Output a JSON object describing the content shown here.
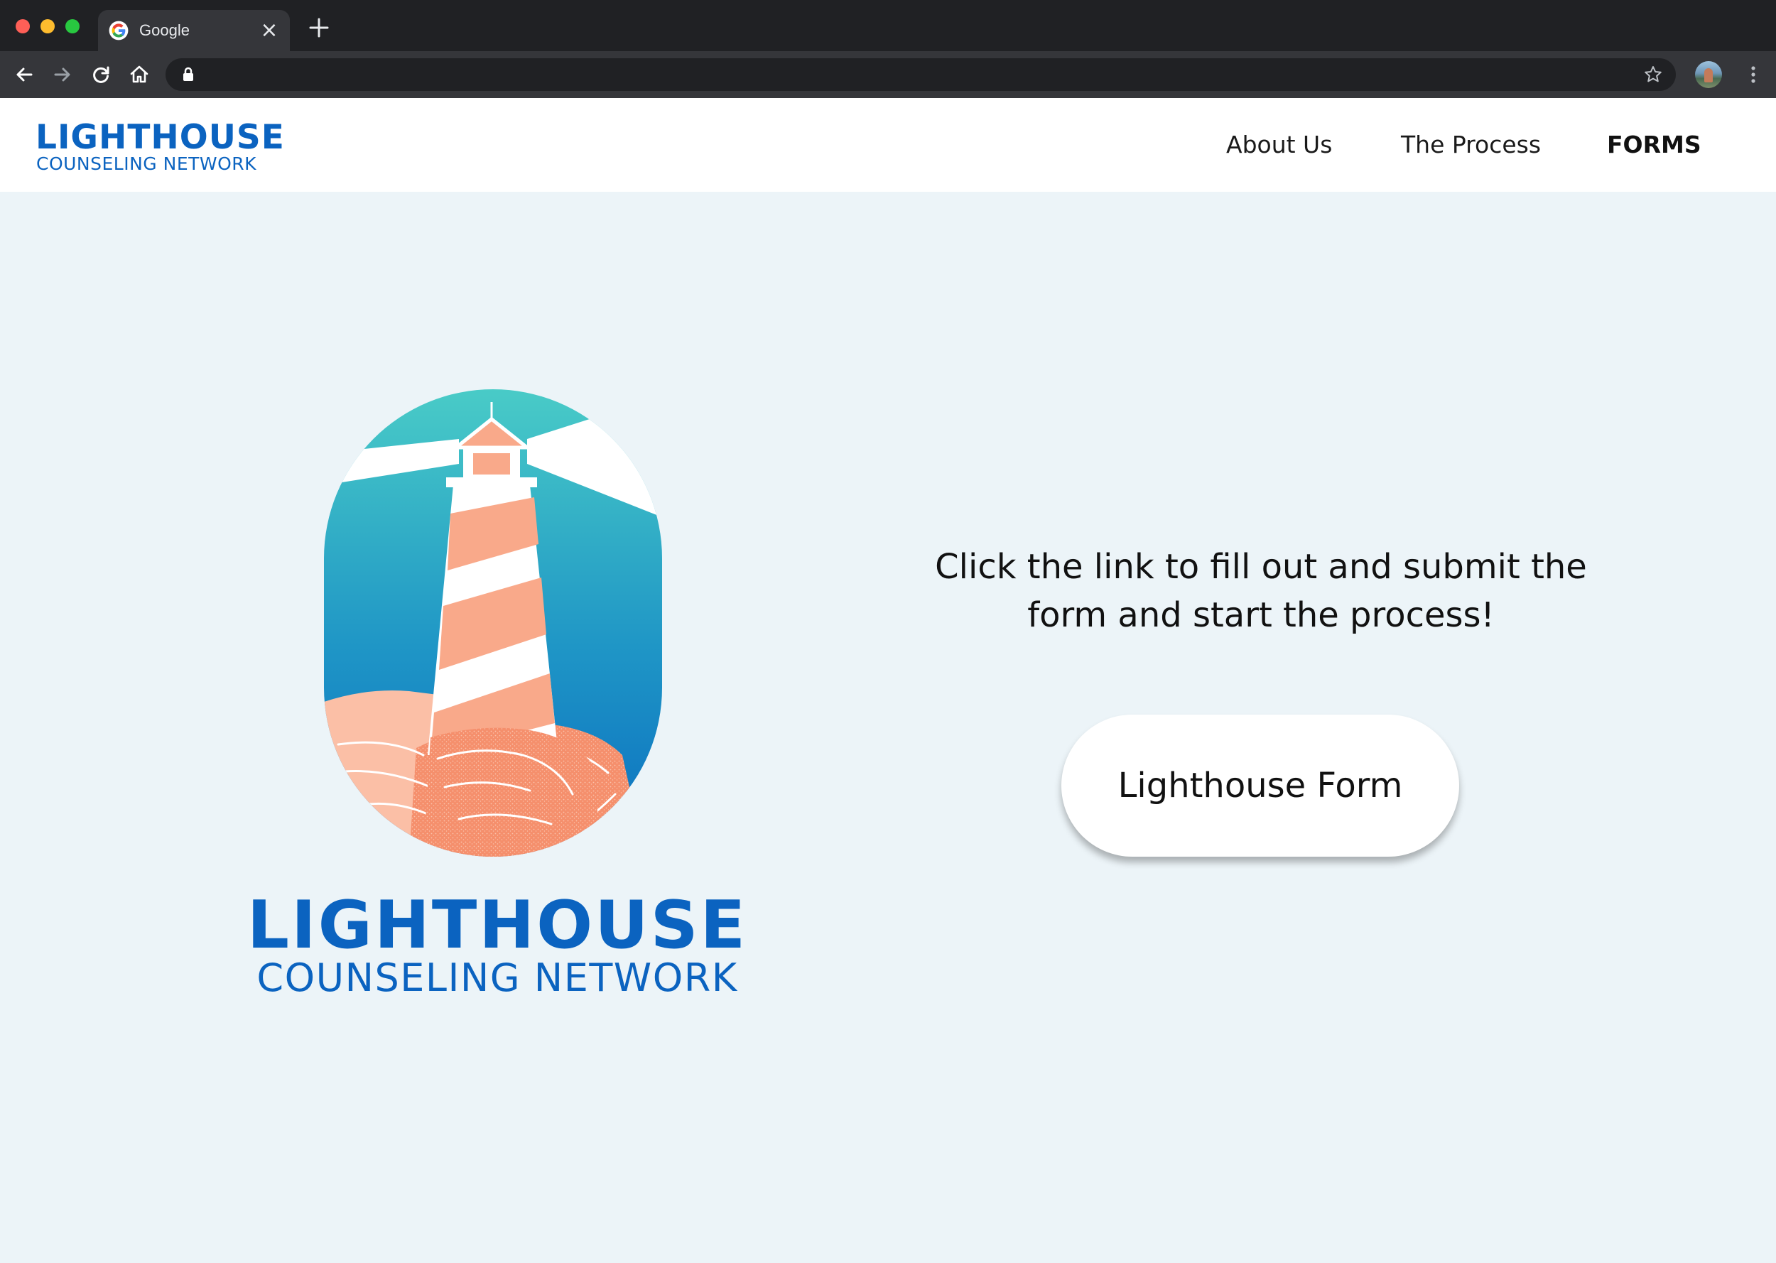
{
  "browser": {
    "tab": {
      "title": "Google",
      "favicon": "google-g-icon",
      "close": "×"
    },
    "toolbar_icons": [
      "back-arrow-icon",
      "forward-arrow-icon",
      "reload-icon",
      "home-icon",
      "lock-icon",
      "star-icon",
      "kebab-menu-icon"
    ],
    "omnibox": {
      "value": ""
    }
  },
  "site": {
    "logo": {
      "main": "LIGHTHOUSE",
      "sub": "COUNSELING NETWORK"
    },
    "nav": [
      {
        "label": "About Us"
      },
      {
        "label": "The Process"
      },
      {
        "label": "FORMS",
        "active": true
      }
    ]
  },
  "main": {
    "logo": {
      "main": "LIGHTHOUSE",
      "sub": "COUNSELING NETWORK"
    },
    "cta_text": "Click the link to fill out and submit the form and start the process!",
    "form_button_label": "Lighthouse Form"
  },
  "colors": {
    "brand_blue": "#0b63c0",
    "page_background": "#ecf4f8",
    "lighthouse_stripe": "#f9a98a",
    "sky_top": "#49cbc7",
    "sky_bottom": "#0a6ec0"
  }
}
